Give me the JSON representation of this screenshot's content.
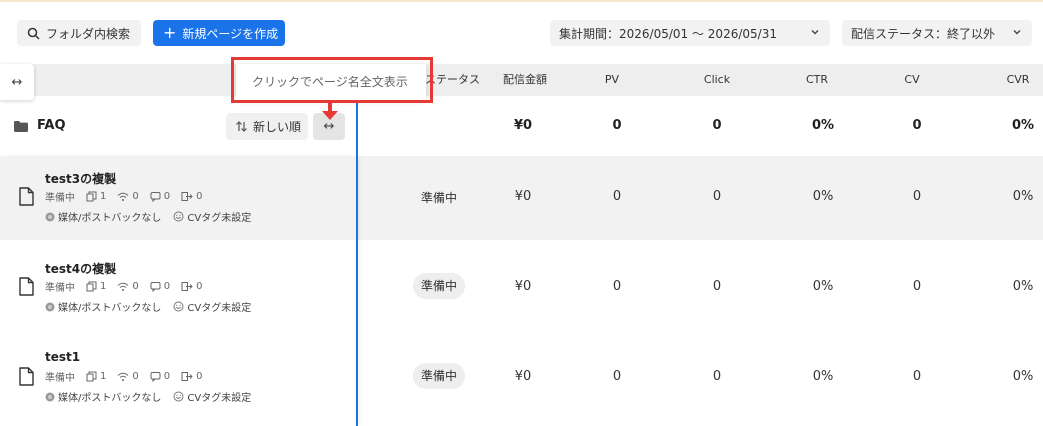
{
  "toolbar": {
    "folder_search_label": "フォルダ内検索",
    "new_page_label": "新規ページを作成",
    "period_label": "集計期間：2026/05/01 〜 2026/05/31",
    "status_filter_label": "配信ステータス：終了以外"
  },
  "tooltip": {
    "text": "クリックでページ名全文表示"
  },
  "columns": {
    "status": "配信ステータス",
    "amount": "配信金額",
    "pv": "PV",
    "click": "Click",
    "ctr": "CTR",
    "cv": "CV",
    "cvr": "CVR"
  },
  "folder": {
    "name": "FAQ",
    "sort_label": "新しい順",
    "amount": "¥0",
    "pv": "0",
    "click": "0",
    "ctr": "0%",
    "cv": "0",
    "cvr": "0%"
  },
  "rows": [
    {
      "title": "test3の複製",
      "state": "準備中",
      "pages": "1",
      "signal": "0",
      "chat": "0",
      "exit": "0",
      "media": "媒体/ポストバックなし",
      "cvtag": "CVタグ未設定",
      "status": "準備中",
      "amount": "¥0",
      "pv": "0",
      "click": "0",
      "ctr": "0%",
      "cv": "0",
      "cvr": "0%"
    },
    {
      "title": "test4の複製",
      "state": "準備中",
      "pages": "1",
      "signal": "0",
      "chat": "0",
      "exit": "0",
      "media": "媒体/ポストバックなし",
      "cvtag": "CVタグ未設定",
      "status": "準備中",
      "amount": "¥0",
      "pv": "0",
      "click": "0",
      "ctr": "0%",
      "cv": "0",
      "cvr": "0%"
    },
    {
      "title": "test1",
      "state": "準備中",
      "pages": "1",
      "signal": "0",
      "chat": "0",
      "exit": "0",
      "media": "媒体/ポストバックなし",
      "cvtag": "CVタグ未設定",
      "status": "準備中",
      "amount": "¥0",
      "pv": "0",
      "click": "0",
      "ctr": "0%",
      "cv": "0",
      "cvr": "0%"
    }
  ],
  "icons": {
    "search": "search-icon",
    "plus": "plus-icon",
    "chevron": "chevron-down-icon",
    "expand": "horizontal-arrows-icon",
    "folder": "folder-icon",
    "sort": "sort-icon",
    "document": "document-icon"
  },
  "colors": {
    "accent": "#1a73e8",
    "highlight": "#e53935"
  }
}
